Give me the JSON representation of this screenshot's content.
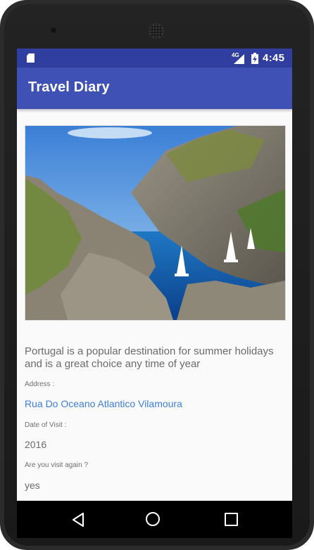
{
  "status_bar": {
    "time": "4:45",
    "network_type": "4G",
    "icons": [
      "sd-card-icon",
      "signal-icon",
      "battery-charging-icon"
    ]
  },
  "app_bar": {
    "title": "Travel Diary"
  },
  "entry": {
    "image": "coastal-cove-photo",
    "description": "Portugal is a popular destination for summer holidays and is a great choice any time of year",
    "address_label": "Address :",
    "address_value": "Rua Do Oceano Atlantico Vilamoura",
    "date_label": "Date of Visit :",
    "date_value": "2016",
    "revisit_label": "Are you visit again ?",
    "revisit_value": "yes"
  },
  "nav_bar": {
    "icons": [
      "back-icon",
      "home-icon",
      "recents-icon"
    ]
  },
  "colors": {
    "status_bar": "#303f9f",
    "app_bar": "#3f51b5",
    "link": "#3d7edb",
    "body_text": "#6b6b6b",
    "background": "#fafafa"
  }
}
